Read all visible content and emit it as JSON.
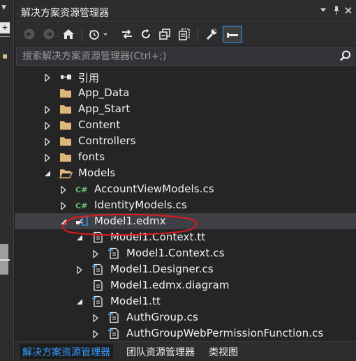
{
  "window": {
    "title": "解决方案资源管理器",
    "title_buttons": [
      {
        "icon": "dropdown-arrow-icon",
        "glyph": "▼"
      },
      {
        "icon": "pin-icon",
        "glyph": "ᵖ"
      },
      {
        "icon": "close-icon",
        "glyph": "✕"
      }
    ]
  },
  "left_strip": {
    "button_glyph": "+"
  },
  "toolbar": {
    "buttons": [
      {
        "icon": "back-icon",
        "active": false
      },
      {
        "icon": "forward-icon",
        "active": false
      },
      {
        "icon": "home-icon",
        "active": false
      },
      {
        "icon": "pending-changes-filter-icon",
        "active": false
      },
      {
        "icon": "sync-with-active-document-icon",
        "active": false
      },
      {
        "icon": "refresh-icon",
        "active": false
      },
      {
        "icon": "collapse-all-icon",
        "active": false
      },
      {
        "icon": "show-all-files-icon",
        "active": false
      },
      {
        "icon": "properties-icon",
        "active": false
      },
      {
        "icon": "preview-selected-items-icon",
        "active": true
      }
    ]
  },
  "search": {
    "placeholder": "搜索解决方案资源管理器(Ctrl+;)"
  },
  "tree": {
    "items": [
      {
        "label": "引用",
        "icon": "references-icon",
        "expander": "collapsed"
      },
      {
        "label": "App_Data",
        "icon": "folder-icon",
        "expander": "none"
      },
      {
        "label": "App_Start",
        "icon": "folder-icon",
        "expander": "collapsed"
      },
      {
        "label": "Content",
        "icon": "folder-icon",
        "expander": "collapsed"
      },
      {
        "label": "Controllers",
        "icon": "folder-icon",
        "expander": "collapsed"
      },
      {
        "label": "fonts",
        "icon": "folder-icon",
        "expander": "collapsed"
      },
      {
        "label": "Models",
        "icon": "folder-open-icon",
        "expander": "expanded"
      },
      {
        "label": "AccountViewModels.cs",
        "icon": "csharp-file-icon",
        "expander": "collapsed"
      },
      {
        "label": "IdentityModels.cs",
        "icon": "csharp-file-icon",
        "expander": "collapsed"
      },
      {
        "label": "Model1.edmx",
        "icon": "edmx-file-icon",
        "expander": "expanded",
        "selected": true
      },
      {
        "label": "Model1.Context.tt",
        "icon": "text-template-icon",
        "expander": "expanded"
      },
      {
        "label": "Model1.Context.cs",
        "icon": "code-file-icon",
        "expander": "collapsed"
      },
      {
        "label": "Model1.Designer.cs",
        "icon": "code-file-icon",
        "expander": "collapsed"
      },
      {
        "label": "Model1.edmx.diagram",
        "icon": "diagram-file-icon",
        "expander": "none"
      },
      {
        "label": "Model1.tt",
        "icon": "text-template-icon",
        "expander": "expanded"
      },
      {
        "label": "AuthGroup.cs",
        "icon": "code-file-icon",
        "expander": "collapsed"
      },
      {
        "label": "AuthGroupWebPermissionFunction.cs",
        "icon": "code-file-icon",
        "expander": "collapsed"
      }
    ]
  },
  "bottom_tabs": [
    {
      "label": "解决方案资源管理器",
      "active": true
    },
    {
      "label": "团队资源管理器",
      "active": false
    },
    {
      "label": "类视图",
      "active": false
    }
  ],
  "colors": {
    "accent": "#3399ff",
    "folder": "#dcb67a",
    "csharp": "#68c07a",
    "annotation": "#e0191b"
  }
}
